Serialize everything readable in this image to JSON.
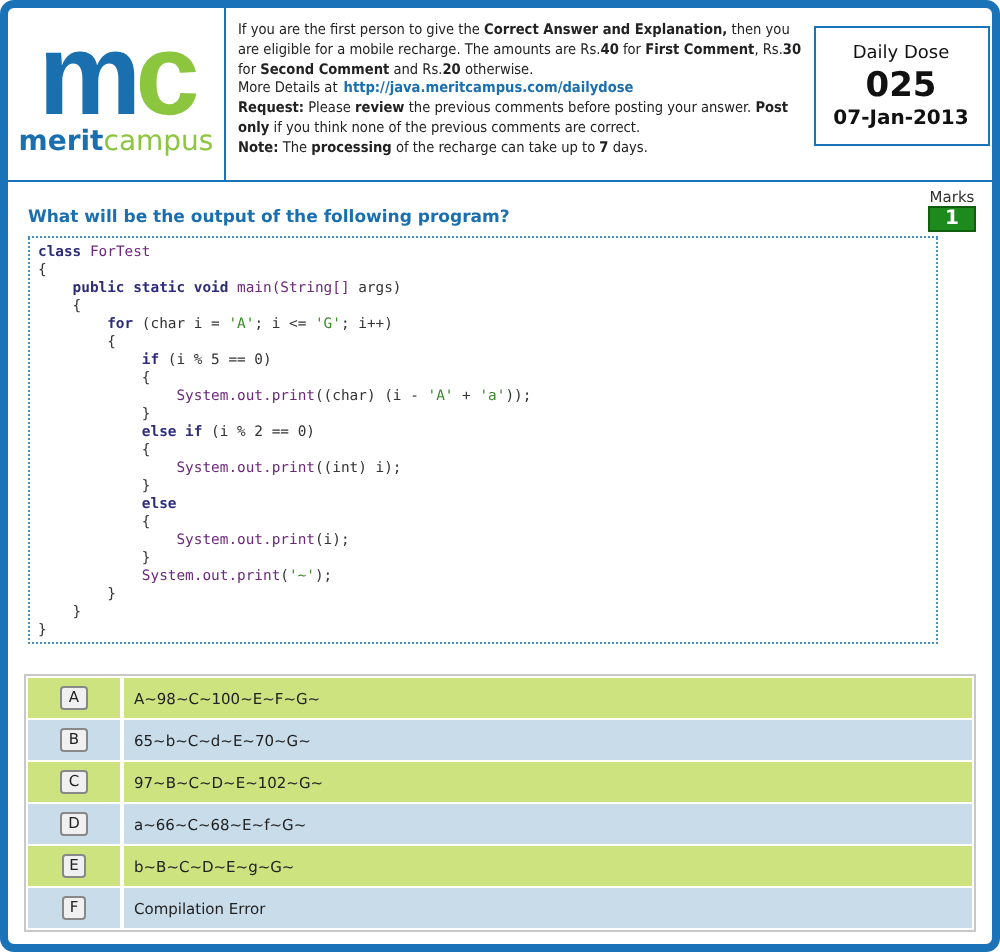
{
  "logo": {
    "mark_1": "m",
    "mark_2": "c",
    "word_1": "merit",
    "word_2": "campus"
  },
  "notice": {
    "intro": "If you are the first person to give the **Correct Answer and Explanation,** then you are eligible for a mobile recharge. The amounts are Rs.**40** for **First Comment**, Rs.**30** for **Second Comment** and Rs.**20** otherwise.",
    "details_label": "More Details at",
    "details_link": "http://java.meritcampus.com/dailydose",
    "request": "**Request:** Please **review** the previous comments before posting your answer.  **Post only** if you think none of the previous comments are correct.",
    "note": "**Note:** The **processing** of the recharge can take up to **7** days."
  },
  "daily_dose": {
    "title": "Daily Dose",
    "number": "025",
    "date": "07-Jan-2013"
  },
  "question": "What will be the output of the following program?",
  "marks": {
    "label": "Marks",
    "value": "1"
  },
  "code": [
    {
      "tokens": [
        {
          "kind": "kw",
          "text": "class "
        },
        {
          "kind": "call",
          "text": "ForTest"
        }
      ]
    },
    {
      "tokens": [
        {
          "kind": "plain",
          "text": "{"
        }
      ],
      "children": [
        {
          "tokens": [
            {
              "kind": "kw",
              "text": "public static void "
            },
            {
              "kind": "call",
              "text": "main(String[] "
            },
            {
              "kind": "plain",
              "text": "args)"
            }
          ]
        },
        {
          "tokens": [
            {
              "kind": "plain",
              "text": "{"
            }
          ],
          "children": [
            {
              "tokens": [
                {
                  "kind": "kw",
                  "text": "for "
                },
                {
                  "kind": "plain",
                  "text": "(char i = "
                },
                {
                  "kind": "str",
                  "text": "'A'"
                },
                {
                  "kind": "plain",
                  "text": "; i <= "
                },
                {
                  "kind": "str",
                  "text": "'G'"
                },
                {
                  "kind": "plain",
                  "text": "; i++)"
                }
              ]
            },
            {
              "tokens": [
                {
                  "kind": "plain",
                  "text": "{"
                }
              ],
              "children": [
                {
                  "tokens": [
                    {
                      "kind": "kw",
                      "text": "if "
                    },
                    {
                      "kind": "plain",
                      "text": "(i % 5 == 0)"
                    }
                  ]
                },
                {
                  "tokens": [
                    {
                      "kind": "plain",
                      "text": "{"
                    }
                  ],
                  "children": [
                    {
                      "tokens": [
                        {
                          "kind": "call",
                          "text": "System.out.print"
                        },
                        {
                          "kind": "plain",
                          "text": "((char) (i - "
                        },
                        {
                          "kind": "str",
                          "text": "'A'"
                        },
                        {
                          "kind": "plain",
                          "text": " + "
                        },
                        {
                          "kind": "str",
                          "text": "'a'"
                        },
                        {
                          "kind": "plain",
                          "text": "));"
                        }
                      ]
                    }
                  ]
                },
                {
                  "tokens": [
                    {
                      "kind": "plain",
                      "text": "}"
                    }
                  ]
                },
                {
                  "tokens": [
                    {
                      "kind": "kw",
                      "text": "else if "
                    },
                    {
                      "kind": "plain",
                      "text": "(i % 2 == 0)"
                    }
                  ]
                },
                {
                  "tokens": [
                    {
                      "kind": "plain",
                      "text": "{"
                    }
                  ],
                  "children": [
                    {
                      "tokens": [
                        {
                          "kind": "call",
                          "text": "System.out.print"
                        },
                        {
                          "kind": "plain",
                          "text": "((int) i);"
                        }
                      ]
                    }
                  ]
                },
                {
                  "tokens": [
                    {
                      "kind": "plain",
                      "text": "}"
                    }
                  ]
                },
                {
                  "tokens": [
                    {
                      "kind": "kw",
                      "text": "else"
                    }
                  ]
                },
                {
                  "tokens": [
                    {
                      "kind": "plain",
                      "text": "{"
                    }
                  ],
                  "children": [
                    {
                      "tokens": [
                        {
                          "kind": "call",
                          "text": "System.out.print"
                        },
                        {
                          "kind": "plain",
                          "text": "(i);"
                        }
                      ]
                    }
                  ]
                },
                {
                  "tokens": [
                    {
                      "kind": "plain",
                      "text": "}"
                    }
                  ]
                },
                {
                  "tokens": [
                    {
                      "kind": "call",
                      "text": "System.out.print"
                    },
                    {
                      "kind": "plain",
                      "text": "("
                    },
                    {
                      "kind": "str",
                      "text": "'~'"
                    },
                    {
                      "kind": "plain",
                      "text": ");"
                    }
                  ]
                }
              ]
            },
            {
              "tokens": [
                {
                  "kind": "plain",
                  "text": "}"
                }
              ]
            }
          ]
        },
        {
          "tokens": [
            {
              "kind": "plain",
              "text": "}"
            }
          ]
        }
      ]
    },
    {
      "tokens": [
        {
          "kind": "plain",
          "text": "}"
        }
      ]
    }
  ],
  "options": [
    {
      "letter": "A",
      "text": "A~98~C~100~E~F~G~"
    },
    {
      "letter": "B",
      "text": "65~b~C~d~E~70~G~"
    },
    {
      "letter": "C",
      "text": "97~B~C~D~E~102~G~"
    },
    {
      "letter": "D",
      "text": "a~66~C~68~E~f~G~"
    },
    {
      "letter": "E",
      "text": "b~B~C~D~E~g~G~"
    },
    {
      "letter": "F",
      "text": "Compilation Error"
    }
  ]
}
